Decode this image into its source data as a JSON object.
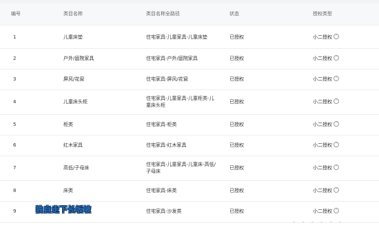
{
  "table": {
    "columns": [
      "编号",
      "类目名称",
      "类目名称全路径",
      "状态",
      "授权类型"
    ],
    "rows": [
      {
        "id": "1",
        "name": "儿童床垫",
        "path": "住宅家具-儿童家具-儿童床垫",
        "status": "已授权",
        "auth_type": "小二授权"
      },
      {
        "id": "2",
        "name": "户外/庭院家具",
        "path": "住宅家具-户外/庭院家具",
        "status": "已授权",
        "auth_type": "小二授权"
      },
      {
        "id": "3",
        "name": "屏风/花窗",
        "path": "住宅家具-屏风/花窗",
        "status": "已授权",
        "auth_type": "小二授权"
      },
      {
        "id": "4",
        "name": "儿童床头柜",
        "path": "住宅家具-儿童家具-儿童柜类-儿童床头柜",
        "status": "已授权",
        "auth_type": "小二授权"
      },
      {
        "id": "5",
        "name": "柜类",
        "path": "住宅家具-柜类",
        "status": "已授权",
        "auth_type": "小二授权"
      },
      {
        "id": "6",
        "name": "红木家具",
        "path": "住宅家具-红木家具",
        "status": "已授权",
        "auth_type": "小二授权"
      },
      {
        "id": "7",
        "name": "高低/子母床",
        "path": "住宅家具-儿童家具-儿童床-高低/子母床",
        "status": "已授权",
        "auth_type": "小二授权"
      },
      {
        "id": "8",
        "name": "床类",
        "path": "住宅家具-床类",
        "status": "已授权",
        "auth_type": "小二授权"
      },
      {
        "id": "9",
        "name": "",
        "path": "住宅家具-沙发类",
        "status": "已授权",
        "auth_type": "小二授权"
      }
    ],
    "help_icon_glyph": "?"
  },
  "overlay_text": "独自走下长坂坡",
  "bottom_fragment": "- - - - - -",
  "colors": {
    "header_bg": "#f7f8fa",
    "divider": "#eceef2",
    "overlay_text": "#2a6fb8"
  }
}
